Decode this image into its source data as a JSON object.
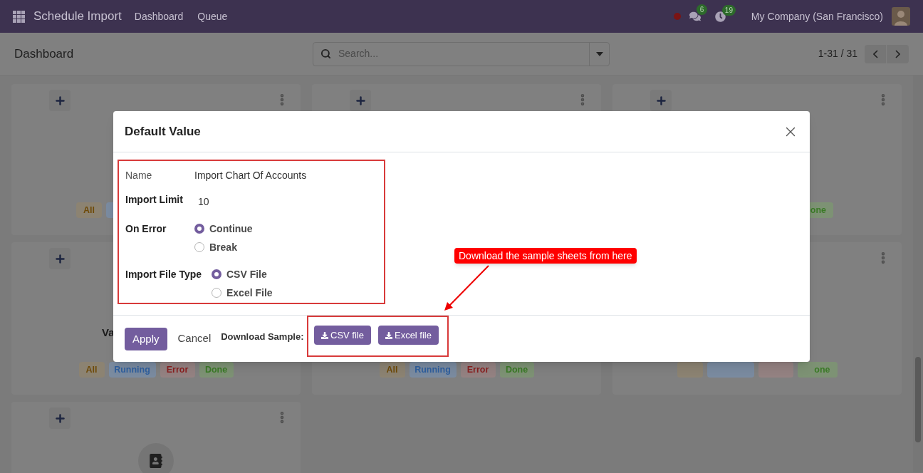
{
  "navbar": {
    "app_title": "Schedule Import",
    "menu": [
      "Dashboard",
      "Queue"
    ],
    "chat_count": "6",
    "activity_count": "19",
    "company": "My Company (San Francisco)"
  },
  "control_panel": {
    "title": "Dashboard",
    "search": {
      "placeholder": "Search..."
    },
    "pager": "1-31 / 31"
  },
  "cards": [
    {
      "kind": "status",
      "tags": [
        {
          "kind": "all",
          "label": "All"
        },
        {
          "kind": "running"
        }
      ]
    },
    {
      "kind": "blank"
    },
    {
      "kind": "status",
      "tags": [
        {
          "kind": "done",
          "label": "one"
        }
      ]
    },
    {
      "kind": "status",
      "title": "Va",
      "tags": [
        {
          "kind": "all",
          "label": "All"
        },
        {
          "kind": "running",
          "label": "Running"
        },
        {
          "kind": "error",
          "label": "Error"
        },
        {
          "kind": "done",
          "label": "Done"
        }
      ]
    },
    {
      "kind": "status",
      "tags": [
        {
          "kind": "all",
          "label": "All"
        },
        {
          "kind": "running",
          "label": "Running"
        },
        {
          "kind": "error",
          "label": "Error"
        },
        {
          "kind": "done",
          "label": "Done"
        }
      ]
    },
    {
      "kind": "status",
      "tags": [
        {
          "kind": "all"
        },
        {
          "kind": "running"
        },
        {
          "kind": "error"
        },
        {
          "kind": "done",
          "label": "one"
        }
      ]
    },
    {
      "kind": "icon"
    }
  ],
  "dialog": {
    "title": "Default Value",
    "fields": [
      {
        "kind": "text",
        "label": "Name",
        "value": "Import Chart Of Accounts"
      },
      {
        "kind": "number",
        "label": "Import Limit",
        "value": "10"
      },
      {
        "kind": "radio",
        "label": "On Error",
        "options": [
          {
            "label": "Continue",
            "selected": true
          },
          {
            "label": "Break",
            "selected": false
          }
        ]
      },
      {
        "kind": "radio",
        "label": "Import File Type",
        "options": [
          {
            "label": "CSV File",
            "selected": true
          },
          {
            "label": "Excel File",
            "selected": false
          }
        ]
      }
    ],
    "buttons": {
      "apply": "Apply",
      "cancel": "Cancel"
    },
    "download": {
      "label": "Download Sample:",
      "buttons": [
        "CSV file",
        "Excel file"
      ]
    }
  },
  "annotation": {
    "callout": "Download the sample sheets from here"
  }
}
